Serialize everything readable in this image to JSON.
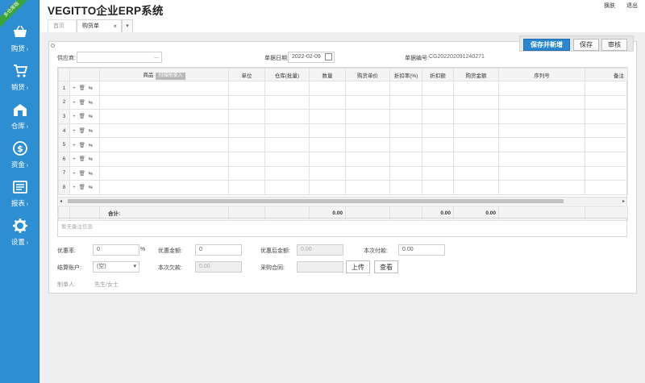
{
  "sidebar": {
    "ribbon": "多仓库版",
    "items": [
      {
        "label": "购货",
        "icon": "basket-icon"
      },
      {
        "label": "销货",
        "icon": "cart-icon"
      },
      {
        "label": "仓库",
        "icon": "warehouse-icon"
      },
      {
        "label": "资金",
        "icon": "dollar-icon"
      },
      {
        "label": "报表",
        "icon": "report-icon"
      },
      {
        "label": "设置",
        "icon": "gear-icon"
      }
    ]
  },
  "header": {
    "title": "VEGITTO企业ERP系统",
    "links": [
      "换肤",
      "退出"
    ]
  },
  "tabs": {
    "home": "首页",
    "active": "购货单",
    "close": "×",
    "more": "▾"
  },
  "toolbar": {
    "save_new": "保存并新增",
    "save": "保存",
    "audit": "审核"
  },
  "form": {
    "supplier_label": "供应商:",
    "supplier_value": "",
    "supplier_more": "...",
    "date_label": "单据日期:",
    "date_value": "2022-02-09",
    "bill_no_label": "单据编号:",
    "bill_no_value": "CG202202091240271"
  },
  "grid": {
    "columns": [
      "",
      "",
      "商品",
      "单位",
      "仓库(批量)",
      "数量",
      "购货单价",
      "折扣率(%)",
      "折扣额",
      "购货金额",
      "序列号",
      "备注"
    ],
    "scan_label": "扫描枪录入",
    "row_ops": "+ 🗑 ⇆",
    "rows": [
      "1",
      "2",
      "3",
      "4",
      "5",
      "6",
      "7",
      "8"
    ],
    "total_label": "合计:",
    "totals": {
      "qty": "0.00",
      "discount": "0.00",
      "amount": "0.00"
    }
  },
  "remark": {
    "placeholder": "暂无备注信息"
  },
  "footer": {
    "discount_rate_label": "优惠率:",
    "discount_rate_value": "0",
    "percent": "%",
    "discount_amount_label": "优惠金额:",
    "discount_amount_value": "0",
    "after_discount_label": "优惠后金额:",
    "after_discount_value": "0.00",
    "this_payment_label": "本次付款:",
    "this_payment_value": "0.00",
    "account_label": "结算账户:",
    "account_value": "(空)",
    "this_debt_label": "本次欠款:",
    "this_debt_value": "0.00",
    "contract_label": "采购合同:",
    "upload": "上传",
    "view": "查看",
    "maker_label": "制单人:",
    "maker_value": "先生/女士"
  },
  "colors": {
    "sidebar": "#2d8fd2",
    "primary_button": "#2a86cf",
    "ribbon": "#3aa33a"
  }
}
